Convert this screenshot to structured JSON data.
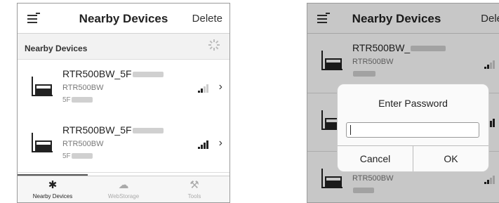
{
  "left": {
    "header": {
      "title": "Nearby Devices",
      "delete_label": "Delete"
    },
    "section": {
      "label": "Nearby Devices"
    },
    "devices": [
      {
        "name": "RTR500BW_5F",
        "model": "RTR500BW",
        "sub": "5F"
      },
      {
        "name": "RTR500BW_5F",
        "model": "RTR500BW",
        "sub": "5F"
      }
    ],
    "tabs": [
      {
        "label": "Nearby Devices",
        "icon": "bluetooth-icon"
      },
      {
        "label": "WebStorage",
        "icon": "cloud-icon"
      },
      {
        "label": "Tools",
        "icon": "wrench-icon"
      }
    ]
  },
  "right": {
    "header": {
      "title": "Nearby Devices",
      "delete_label": "Dele"
    },
    "devices": [
      {
        "name": "RTR500BW_",
        "model": "RTR500BW"
      },
      {
        "name": "",
        "model": ""
      },
      {
        "name": "",
        "model": "RTR500BW"
      }
    ],
    "dialog": {
      "title": "Enter Password",
      "password_value": "",
      "cancel_label": "Cancel",
      "ok_label": "OK"
    }
  },
  "colors": {
    "text": "#222222",
    "muted": "#777777",
    "divider": "#dddddd",
    "overlay": "rgba(0,0,0,0.22)"
  }
}
